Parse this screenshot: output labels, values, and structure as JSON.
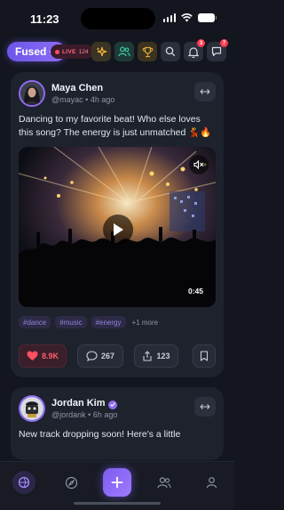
{
  "status_bar": {
    "time": "11:23"
  },
  "top_bar": {
    "brand": "Fused",
    "live_label": "LIVE",
    "live_count": "124",
    "notifications_badge": "3",
    "messages_badge": "7"
  },
  "posts": [
    {
      "author": "Maya Chen",
      "handle": "@mayac",
      "time_ago": "4h ago",
      "text": "Dancing to my favorite beat! Who else loves this song? The energy is just unmatched 💃🔥",
      "video_duration": "0:45",
      "tags": [
        "#dance",
        "#music",
        "#energy"
      ],
      "tags_more": "+1 more",
      "likes": "8.9K",
      "comments": "267",
      "shares": "123",
      "liked": true
    },
    {
      "author": "Jordan Kim",
      "handle": "@jordank",
      "time_ago": "6h ago",
      "text": "New track dropping soon! Here's a little",
      "verified": true
    }
  ],
  "bottom_nav": [
    "home",
    "explore",
    "create",
    "community",
    "profile"
  ],
  "colors": {
    "accent": "#8d6cf6",
    "like": "#ff5d6e",
    "live": "#ff4f62",
    "background": "#13161f",
    "card": "#1e222d"
  }
}
